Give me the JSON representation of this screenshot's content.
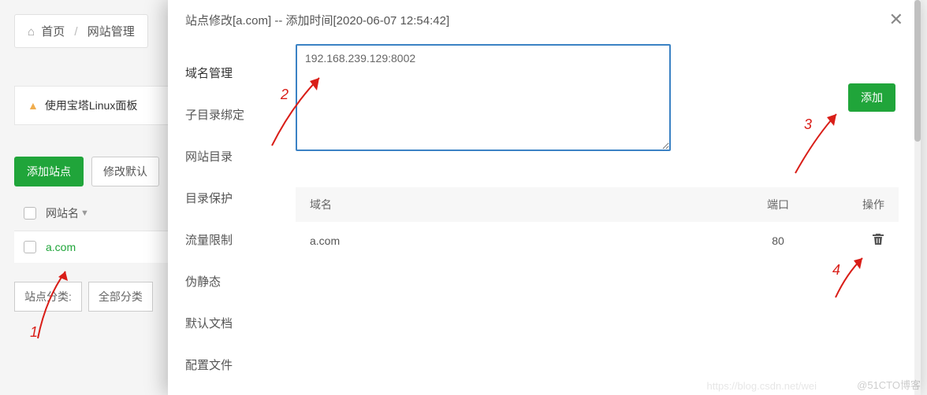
{
  "breadcrumb": {
    "home": "首页",
    "section": "网站管理"
  },
  "info_bar": {
    "text": "使用宝塔Linux面板"
  },
  "bg_buttons": {
    "add_site": "添加站点",
    "modify_default": "修改默认"
  },
  "bg_table": {
    "header": "网站名",
    "rows": [
      {
        "name": "a.com"
      }
    ]
  },
  "filter": {
    "label": "站点分类:",
    "value": "全部分类"
  },
  "modal": {
    "title": "站点修改[a.com] -- 添加时间[2020-06-07 12:54:42]",
    "sidebar": [
      "域名管理",
      "子目录绑定",
      "网站目录",
      "目录保护",
      "流量限制",
      "伪静态",
      "默认文档",
      "配置文件"
    ],
    "textarea_value": "192.168.239.129:8002",
    "add_button": "添加",
    "table": {
      "col_domain": "域名",
      "col_port": "端口",
      "col_op": "操作",
      "rows": [
        {
          "domain": "a.com",
          "port": "80"
        }
      ]
    }
  },
  "annotations": {
    "n1": "1",
    "n2": "2",
    "n3": "3",
    "n4": "4"
  },
  "watermark": "@51CTO博客",
  "watermark_faint": "https://blog.csdn.net/wei"
}
